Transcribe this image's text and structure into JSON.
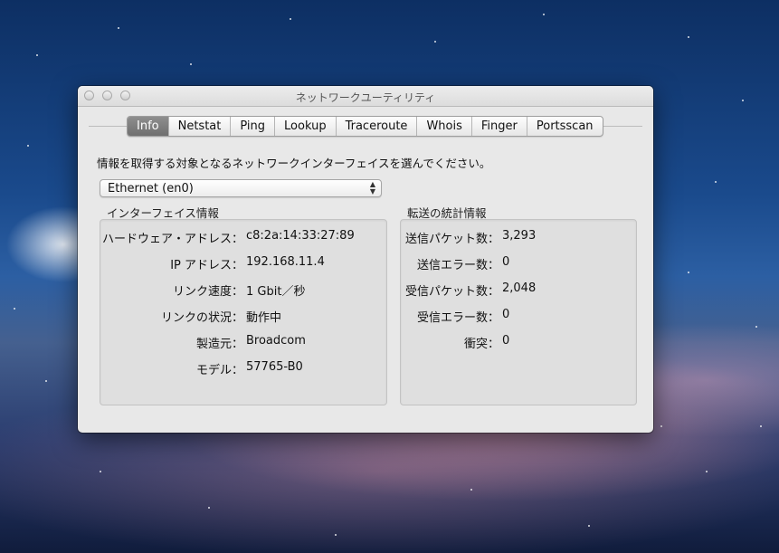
{
  "window": {
    "title": "ネットワークユーティリティ"
  },
  "tabs": [
    {
      "label": "Info",
      "active": true
    },
    {
      "label": "Netstat",
      "active": false
    },
    {
      "label": "Ping",
      "active": false
    },
    {
      "label": "Lookup",
      "active": false
    },
    {
      "label": "Traceroute",
      "active": false
    },
    {
      "label": "Whois",
      "active": false
    },
    {
      "label": "Finger",
      "active": false
    },
    {
      "label": "Portsscan",
      "active": false
    }
  ],
  "prompt": "情報を取得する対象となるネットワークインターフェイスを選んでください。",
  "interface_select": {
    "selected": "Ethernet (en0)",
    "arrows_icon": "updown-chevron-icon"
  },
  "interface_info": {
    "title": "インターフェイス情報",
    "rows": [
      {
        "label": "ハードウェア・アドレス：",
        "value": "c8:2a:14:33:27:89"
      },
      {
        "label": "IP アドレス：",
        "value": "192.168.11.4"
      },
      {
        "label": "リンク速度：",
        "value": "1 Gbit／秒"
      },
      {
        "label": "リンクの状況：",
        "value": "動作中"
      },
      {
        "label": "製造元：",
        "value": "Broadcom"
      },
      {
        "label": "モデル：",
        "value": "57765-B0"
      }
    ]
  },
  "transfer_stats": {
    "title": "転送の統計情報",
    "rows": [
      {
        "label": "送信パケット数：",
        "value": "3,293"
      },
      {
        "label": "送信エラー数：",
        "value": "0"
      },
      {
        "label": "受信パケット数：",
        "value": "2,048"
      },
      {
        "label": "受信エラー数：",
        "value": "0"
      },
      {
        "label": "衝突：",
        "value": "0"
      }
    ]
  }
}
